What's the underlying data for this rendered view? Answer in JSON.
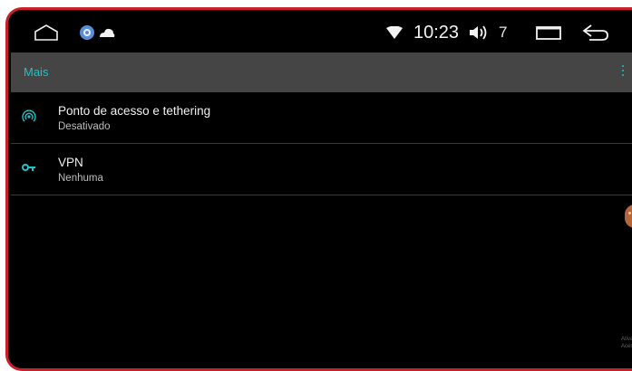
{
  "status_bar": {
    "time": "10:23",
    "volume": "7",
    "icons": [
      "home-icon",
      "app-icon",
      "cloud-icon",
      "wifi-icon",
      "volume-icon",
      "recents-icon",
      "back-icon"
    ]
  },
  "app_bar": {
    "title": "Mais",
    "menu_icon": "overflow-menu-icon"
  },
  "settings": [
    {
      "title": "Ponto de acesso e tethering",
      "subtitle": "Desativado",
      "icon": "hotspot-icon"
    },
    {
      "title": "VPN",
      "subtitle": "Nenhuma",
      "icon": "key-icon"
    }
  ],
  "watermark": {
    "line1": "Ativar",
    "line2": "Acesse"
  },
  "colors": {
    "accent": "#1ec3c8",
    "app_bar": "#454545",
    "background": "#000000",
    "bezel": "#c8202a"
  }
}
